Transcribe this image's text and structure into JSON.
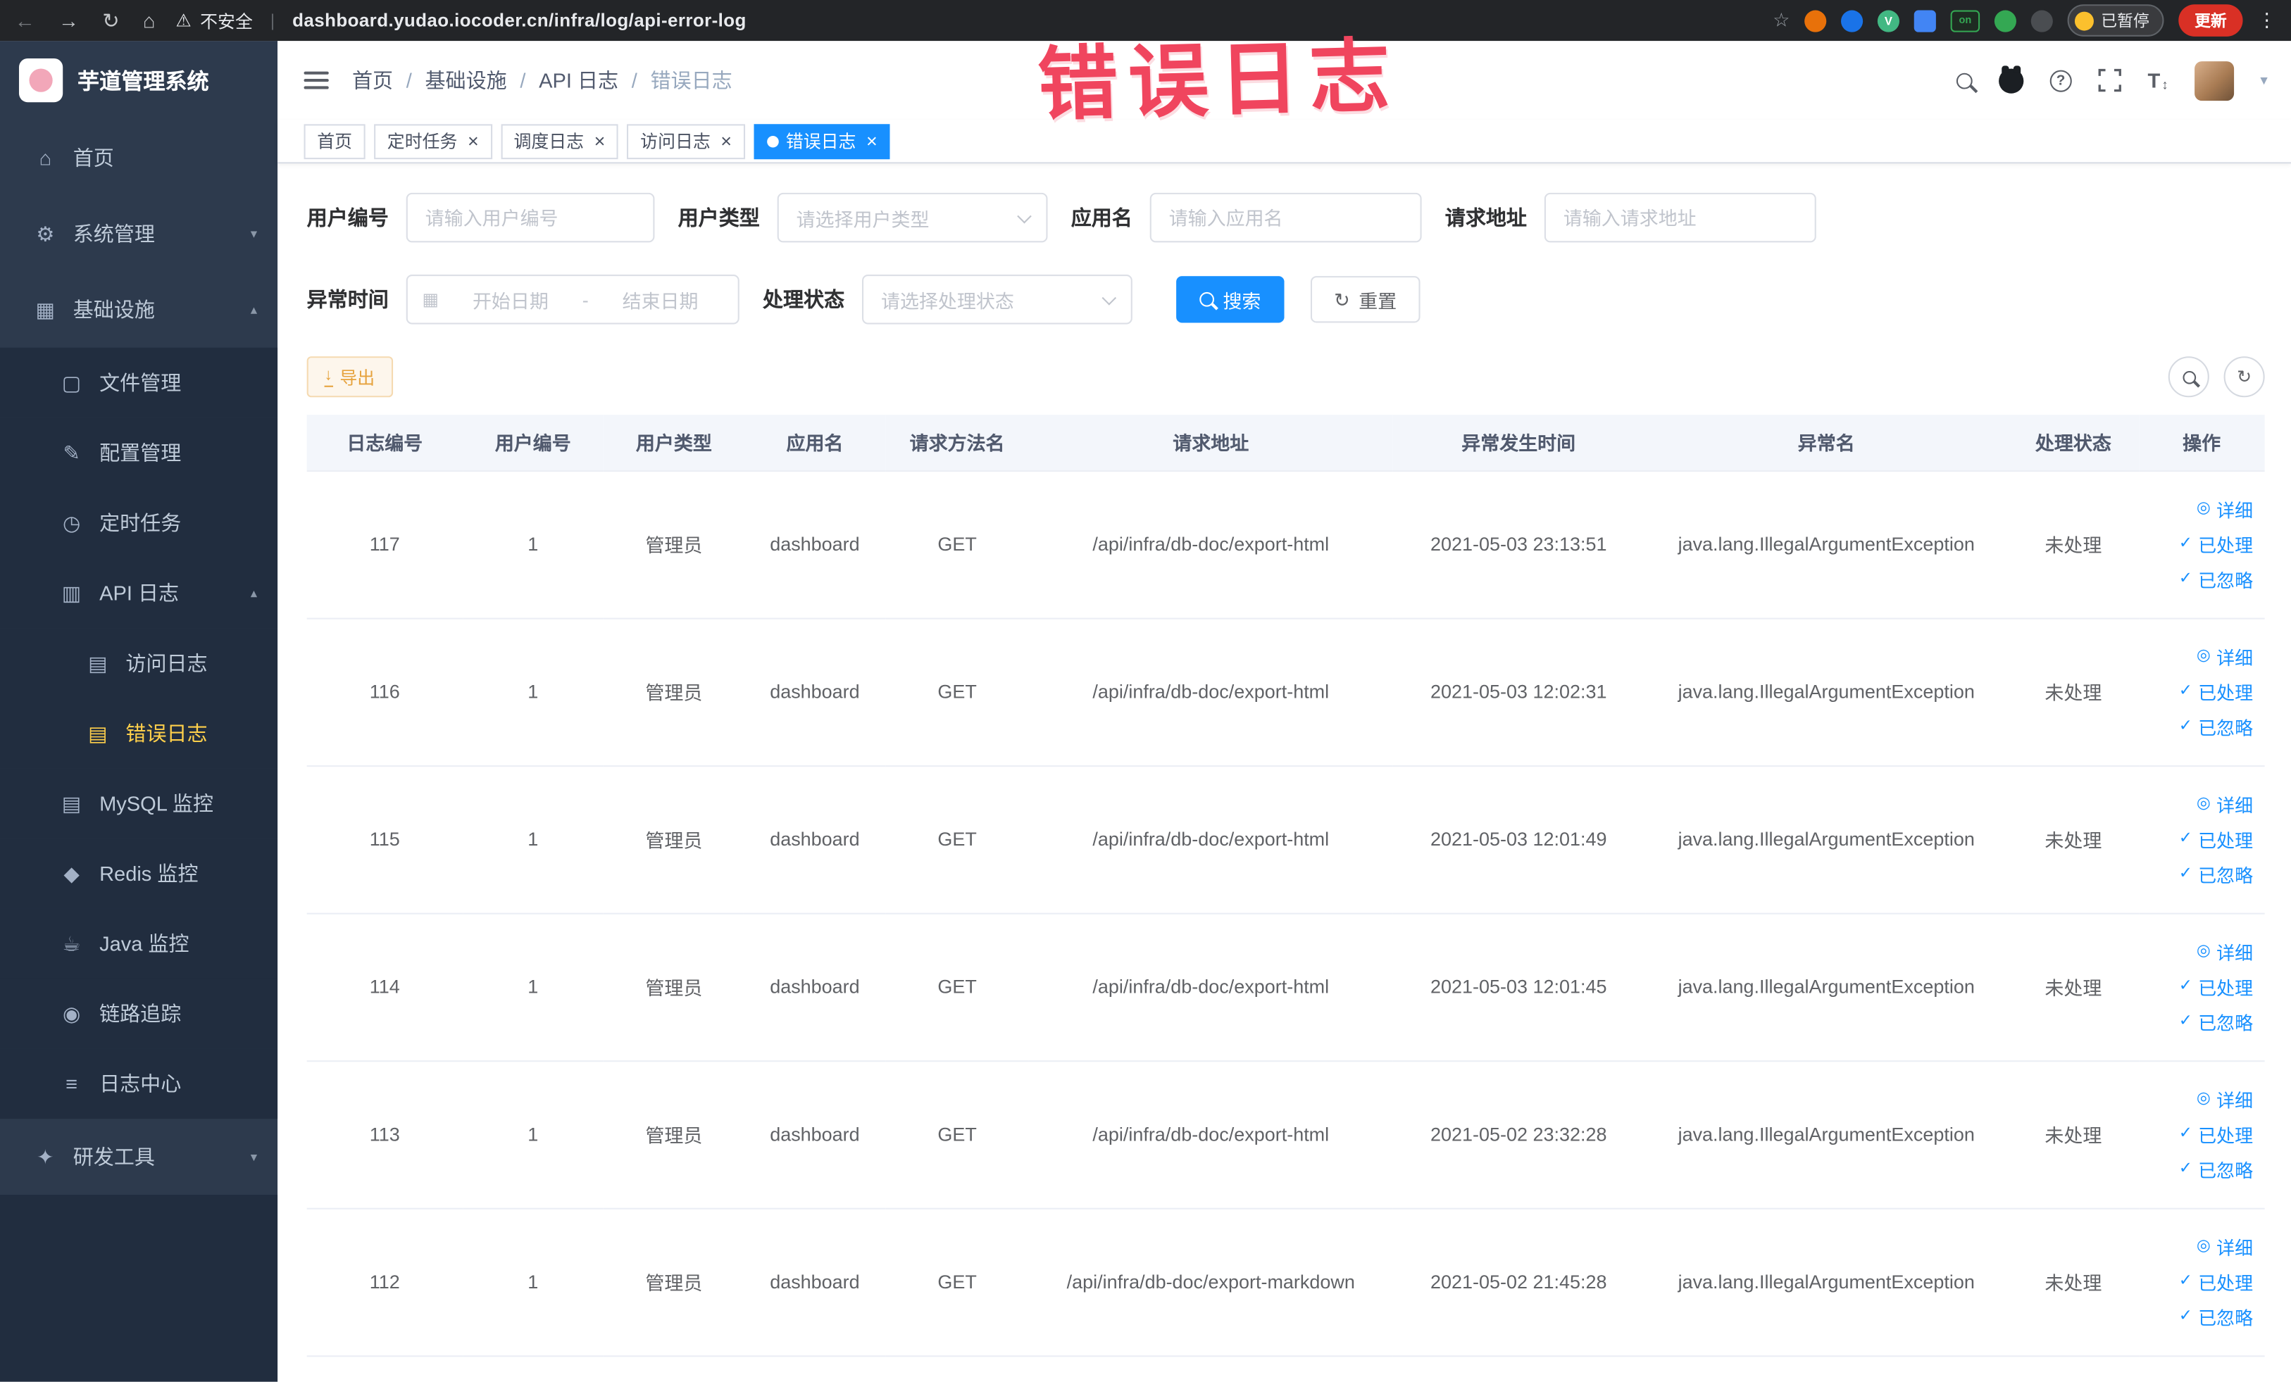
{
  "browser": {
    "security_label": "不安全",
    "url": "dashboard.yudao.iocoder.cn/infra/log/api-error-log",
    "extension_on_text": "on",
    "paused_label": "已暂停",
    "update_label": "更新"
  },
  "watermark": {
    "text": "错误日志",
    "color": "#f0455e"
  },
  "sidebar": {
    "logo_title": "芋道管理系统",
    "items": [
      {
        "key": "home",
        "label": "首页",
        "icon": "home-icon",
        "depth": 1,
        "chevron": null,
        "active": false
      },
      {
        "key": "system",
        "label": "系统管理",
        "icon": "gear-icon",
        "depth": 1,
        "chevron": "down",
        "active": false
      },
      {
        "key": "infra",
        "label": "基础设施",
        "icon": "infra-icon",
        "depth": 1,
        "chevron": "up",
        "active": false
      },
      {
        "key": "file",
        "label": "文件管理",
        "icon": "file-icon",
        "depth": 2,
        "chevron": null,
        "active": false
      },
      {
        "key": "config",
        "label": "配置管理",
        "icon": "config-icon",
        "depth": 2,
        "chevron": null,
        "active": false
      },
      {
        "key": "job",
        "label": "定时任务",
        "icon": "clock-icon",
        "depth": 2,
        "chevron": null,
        "active": false
      },
      {
        "key": "api-log",
        "label": "API 日志",
        "icon": "api-log-icon",
        "depth": 2,
        "chevron": "up",
        "active": false
      },
      {
        "key": "access-log",
        "label": "访问日志",
        "icon": "access-log-icon",
        "depth": 3,
        "chevron": null,
        "active": false
      },
      {
        "key": "error-log",
        "label": "错误日志",
        "icon": "error-log-icon",
        "depth": 3,
        "chevron": null,
        "active": true
      },
      {
        "key": "mysql",
        "label": "MySQL 监控",
        "icon": "mysql-icon",
        "depth": 2,
        "chevron": null,
        "active": false
      },
      {
        "key": "redis",
        "label": "Redis 监控",
        "icon": "redis-icon",
        "depth": 2,
        "chevron": null,
        "active": false
      },
      {
        "key": "java",
        "label": "Java 监控",
        "icon": "java-icon",
        "depth": 2,
        "chevron": null,
        "active": false
      },
      {
        "key": "trace",
        "label": "链路追踪",
        "icon": "trace-icon",
        "depth": 2,
        "chevron": null,
        "active": false
      },
      {
        "key": "log-center",
        "label": "日志中心",
        "icon": "log-center-icon",
        "depth": 2,
        "chevron": null,
        "active": false
      },
      {
        "key": "devtools",
        "label": "研发工具",
        "icon": "devtools-icon",
        "depth": 1,
        "chevron": "down",
        "active": false
      }
    ]
  },
  "header": {
    "breadcrumb": [
      "首页",
      "基础设施",
      "API 日志",
      "错误日志"
    ]
  },
  "tabs": [
    {
      "key": "home",
      "label": "首页",
      "closable": false,
      "active": false
    },
    {
      "key": "cron-job",
      "label": "定时任务",
      "closable": true,
      "active": false
    },
    {
      "key": "job-log",
      "label": "调度日志",
      "closable": true,
      "active": false
    },
    {
      "key": "access-log",
      "label": "访问日志",
      "closable": true,
      "active": false
    },
    {
      "key": "error-log",
      "label": "错误日志",
      "closable": true,
      "active": true
    }
  ],
  "filters": {
    "user_id": {
      "label": "用户编号",
      "placeholder": "请输入用户编号"
    },
    "user_type": {
      "label": "用户类型",
      "placeholder": "请选择用户类型"
    },
    "app_name": {
      "label": "应用名",
      "placeholder": "请输入应用名"
    },
    "request_url": {
      "label": "请求地址",
      "placeholder": "请输入请求地址"
    },
    "exception_time": {
      "label": "异常时间",
      "start_placeholder": "开始日期",
      "separator": "-",
      "end_placeholder": "结束日期"
    },
    "process_status": {
      "label": "处理状态",
      "placeholder": "请选择处理状态"
    },
    "search_button": "搜索",
    "reset_button": "重置"
  },
  "toolbar": {
    "export_label": "导出"
  },
  "table": {
    "columns": [
      "日志编号",
      "用户编号",
      "用户类型",
      "应用名",
      "请求方法名",
      "请求地址",
      "异常发生时间",
      "异常名",
      "处理状态",
      "操作"
    ],
    "row_keys": [
      "id",
      "user_id",
      "user_type",
      "app",
      "method",
      "url",
      "time",
      "exception",
      "status"
    ],
    "row_actions": [
      {
        "key": "detail",
        "label": "详细",
        "icon": "eye-icon"
      },
      {
        "key": "done",
        "label": "已处理",
        "icon": "check-icon"
      },
      {
        "key": "ignored",
        "label": "已忽略",
        "icon": "check-icon"
      }
    ],
    "rows": [
      {
        "id": "117",
        "user_id": "1",
        "user_type": "管理员",
        "app": "dashboard",
        "method": "GET",
        "url": "/api/infra/db-doc/export-html",
        "time": "2021-05-03 23:13:51",
        "exception": "java.lang.IllegalArgumentException",
        "status": "未处理"
      },
      {
        "id": "116",
        "user_id": "1",
        "user_type": "管理员",
        "app": "dashboard",
        "method": "GET",
        "url": "/api/infra/db-doc/export-html",
        "time": "2021-05-03 12:02:31",
        "exception": "java.lang.IllegalArgumentException",
        "status": "未处理"
      },
      {
        "id": "115",
        "user_id": "1",
        "user_type": "管理员",
        "app": "dashboard",
        "method": "GET",
        "url": "/api/infra/db-doc/export-html",
        "time": "2021-05-03 12:01:49",
        "exception": "java.lang.IllegalArgumentException",
        "status": "未处理"
      },
      {
        "id": "114",
        "user_id": "1",
        "user_type": "管理员",
        "app": "dashboard",
        "method": "GET",
        "url": "/api/infra/db-doc/export-html",
        "time": "2021-05-03 12:01:45",
        "exception": "java.lang.IllegalArgumentException",
        "status": "未处理"
      },
      {
        "id": "113",
        "user_id": "1",
        "user_type": "管理员",
        "app": "dashboard",
        "method": "GET",
        "url": "/api/infra/db-doc/export-html",
        "time": "2021-05-02 23:32:28",
        "exception": "java.lang.IllegalArgumentException",
        "status": "未处理"
      },
      {
        "id": "112",
        "user_id": "1",
        "user_type": "管理员",
        "app": "dashboard",
        "method": "GET",
        "url": "/api/infra/db-doc/export-markdown",
        "time": "2021-05-02 21:45:28",
        "exception": "java.lang.IllegalArgumentException",
        "status": "未处理"
      }
    ]
  },
  "colors": {
    "accent": "#1890ff",
    "sidebar_bg": "#2d3a4d",
    "sidebar_submenu_bg": "#212d3f",
    "sidebar_active_text": "#ffd04b",
    "warning_button": "#e6a23c",
    "watermark": "#f0455e"
  },
  "icon_glyphs": {
    "back-icon": "←",
    "forward-icon": "→",
    "reload-icon": "↻",
    "browser-home-icon": "⌂",
    "warning-icon": "⚠",
    "star-icon": "☆",
    "menu-dots-icon": "⋮",
    "home-icon": "⌂",
    "gear-icon": "⚙",
    "infra-icon": "▦",
    "file-icon": "▢",
    "config-icon": "✎",
    "clock-icon": "◷",
    "api-log-icon": "▥",
    "access-log-icon": "▤",
    "error-log-icon": "▤",
    "mysql-icon": "▤",
    "redis-icon": "◆",
    "java-icon": "☕",
    "trace-icon": "◉",
    "log-center-icon": "≡",
    "devtools-icon": "✦",
    "chevron-up-icon": "▴",
    "chevron-down-icon": "▾",
    "caret-down-icon": "▾",
    "updown-icon": "↕",
    "calendar-icon": "▦",
    "refresh-icon": "↻",
    "download-icon": "↓",
    "eye-icon": "◎",
    "check-icon": "✓",
    "close-icon": "×"
  }
}
